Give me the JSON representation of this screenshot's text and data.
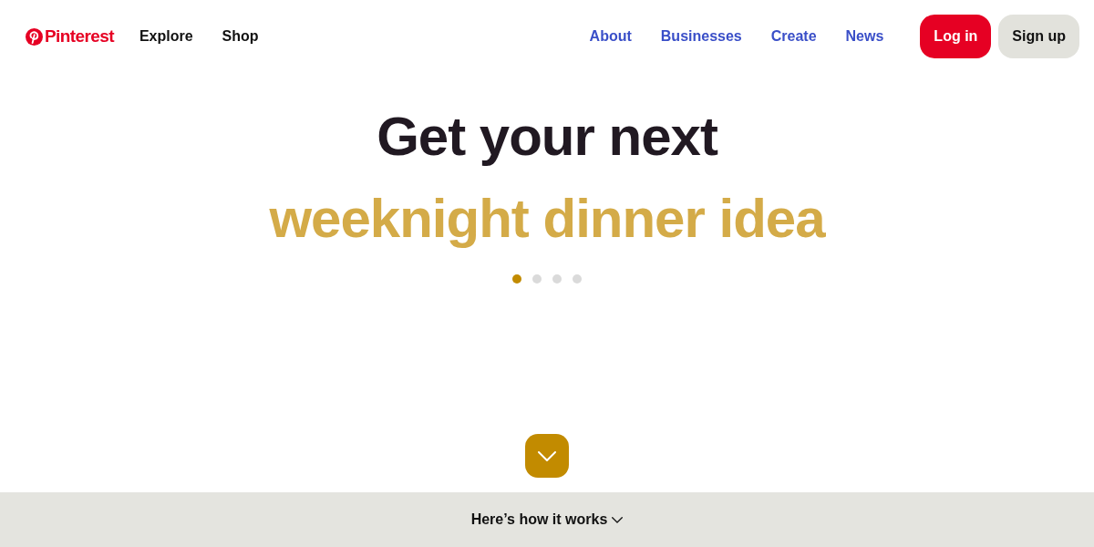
{
  "header": {
    "logo": {
      "text": "Pinterest"
    },
    "nav_left": [
      "Explore",
      "Shop"
    ],
    "nav_right": [
      "About",
      "Businesses",
      "Create",
      "News"
    ],
    "buttons": [
      {
        "label": "Log in",
        "kind": "primary"
      },
      {
        "label": "Sign up",
        "kind": "secondary"
      }
    ]
  },
  "hero": {
    "title": "Get your next",
    "subtitle": "weeknight dinner idea",
    "dots": [
      {
        "selected": true
      },
      {
        "selected": false
      },
      {
        "selected": false
      },
      {
        "selected": false
      }
    ]
  },
  "footer_bar": {
    "label": "Here’s how it works"
  }
}
